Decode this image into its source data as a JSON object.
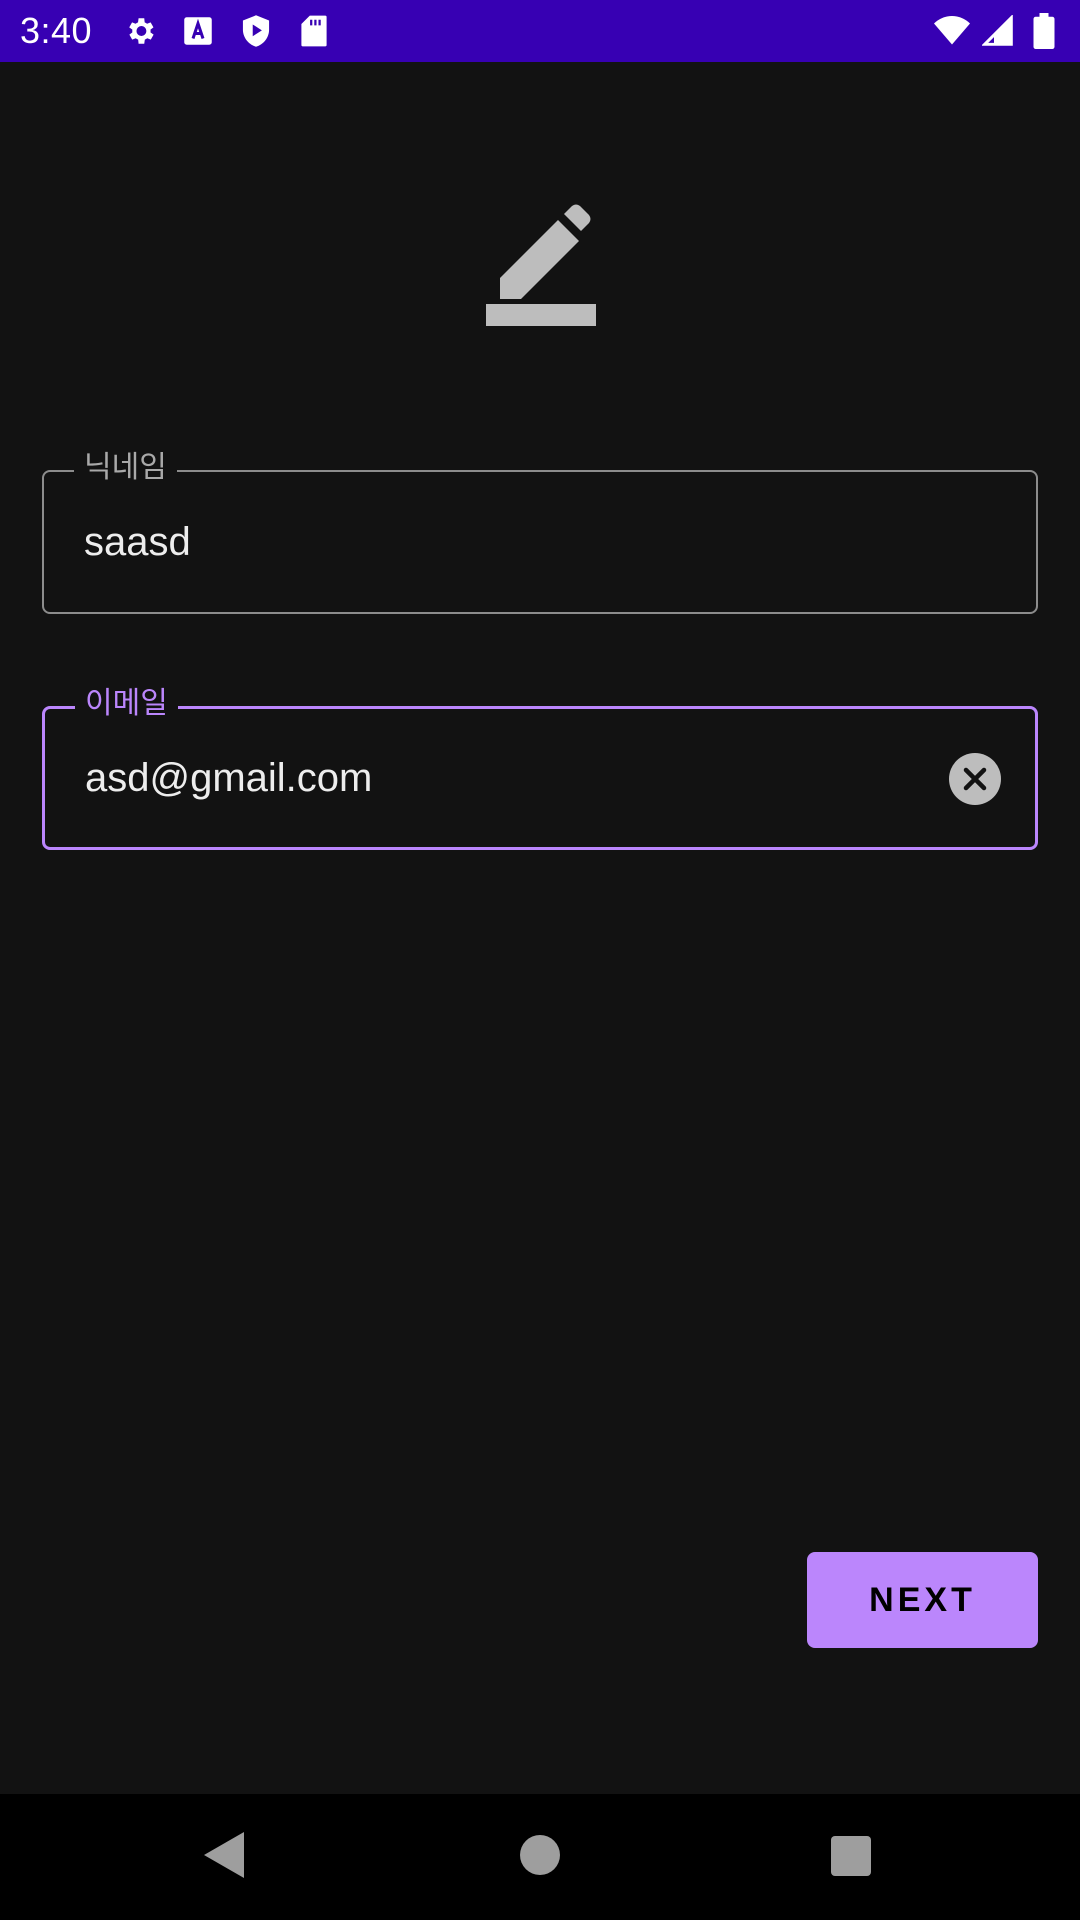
{
  "status_bar": {
    "time": "3:40",
    "left_icons": [
      "gear-icon",
      "font-a-icon",
      "play-shield-icon",
      "sd-card-icon"
    ],
    "right_icons": [
      "wifi-icon",
      "cell-signal-icon",
      "battery-icon"
    ]
  },
  "header": {
    "icon": "edit-pencil-icon"
  },
  "form": {
    "nickname": {
      "label": "닉네임",
      "value": "saasd"
    },
    "email": {
      "label": "이메일",
      "value": "asd@gmail.com",
      "clear_icon": "clear-circle-icon"
    }
  },
  "actions": {
    "next_label": "NEXT"
  },
  "nav_bar": {
    "icons": [
      "back-triangle-icon",
      "home-circle-icon",
      "recents-square-icon"
    ]
  },
  "colors": {
    "status_bar": "#3700b3",
    "background": "#121212",
    "accent": "#bb86fc",
    "outline": "#8c8c8c"
  }
}
